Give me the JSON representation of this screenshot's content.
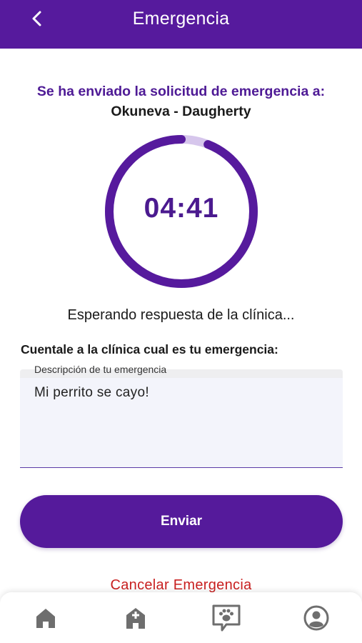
{
  "app_bar": {
    "title": "Emergencia",
    "back_icon": "chevron-left-icon"
  },
  "status": {
    "sent_title": "Se ha enviado la solicitud de emergencia a:",
    "clinic_name": "Okuneva - Daugherty",
    "timer": "04:41",
    "timer_progress": 0.94,
    "waiting_text": "Esperando respuesta de la clínica..."
  },
  "form": {
    "prompt": "Cuentale a la clínica cual es tu emergencia:",
    "field_label": "Descripción de tu emergencia",
    "field_value": "Mi perrito se cayo!",
    "send_label": "Enviar",
    "cancel_label": "Cancelar Emergencia"
  },
  "bottom_nav": {
    "items": [
      {
        "icon": "home-icon"
      },
      {
        "icon": "clinic-icon"
      },
      {
        "icon": "paw-chat-icon"
      },
      {
        "icon": "profile-icon"
      }
    ]
  },
  "colors": {
    "primary": "#561a9d",
    "track": "#d6c6ec",
    "danger": "#c81f1f"
  }
}
